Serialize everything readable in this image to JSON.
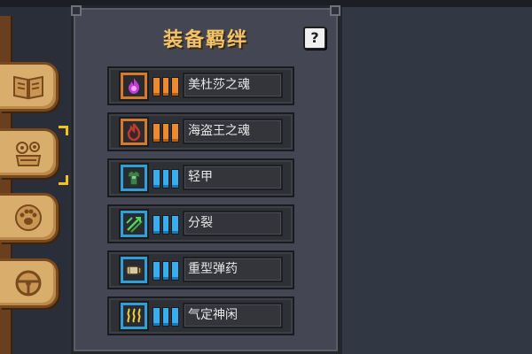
{
  "panel": {
    "title": "装备羁绊",
    "help_label": "?"
  },
  "side_tabs": [
    {
      "icon": "book-icon"
    },
    {
      "icon": "gear-clouds-icon",
      "selected": true
    },
    {
      "icon": "paw-icon"
    },
    {
      "icon": "steering-wheel-icon"
    }
  ],
  "bonds": [
    {
      "name": "美杜莎之魂",
      "tier_color": "orange",
      "icon": "purple-flame-icon"
    },
    {
      "name": "海盗王之魂",
      "tier_color": "orange",
      "icon": "red-flame-icon"
    },
    {
      "name": "轻甲",
      "tier_color": "blue",
      "icon": "light-armor-icon"
    },
    {
      "name": "分裂",
      "tier_color": "blue",
      "icon": "split-arrows-icon"
    },
    {
      "name": "重型弹药",
      "tier_color": "blue",
      "icon": "heavy-ammo-icon"
    },
    {
      "name": "气定神闲",
      "tier_color": "blue",
      "icon": "calm-aura-icon"
    }
  ],
  "colors": {
    "title": "#f3c36a",
    "orange_tier": "#ee8a2e",
    "blue_tier": "#38aef0",
    "tab_wood": "#d9ae6c"
  }
}
